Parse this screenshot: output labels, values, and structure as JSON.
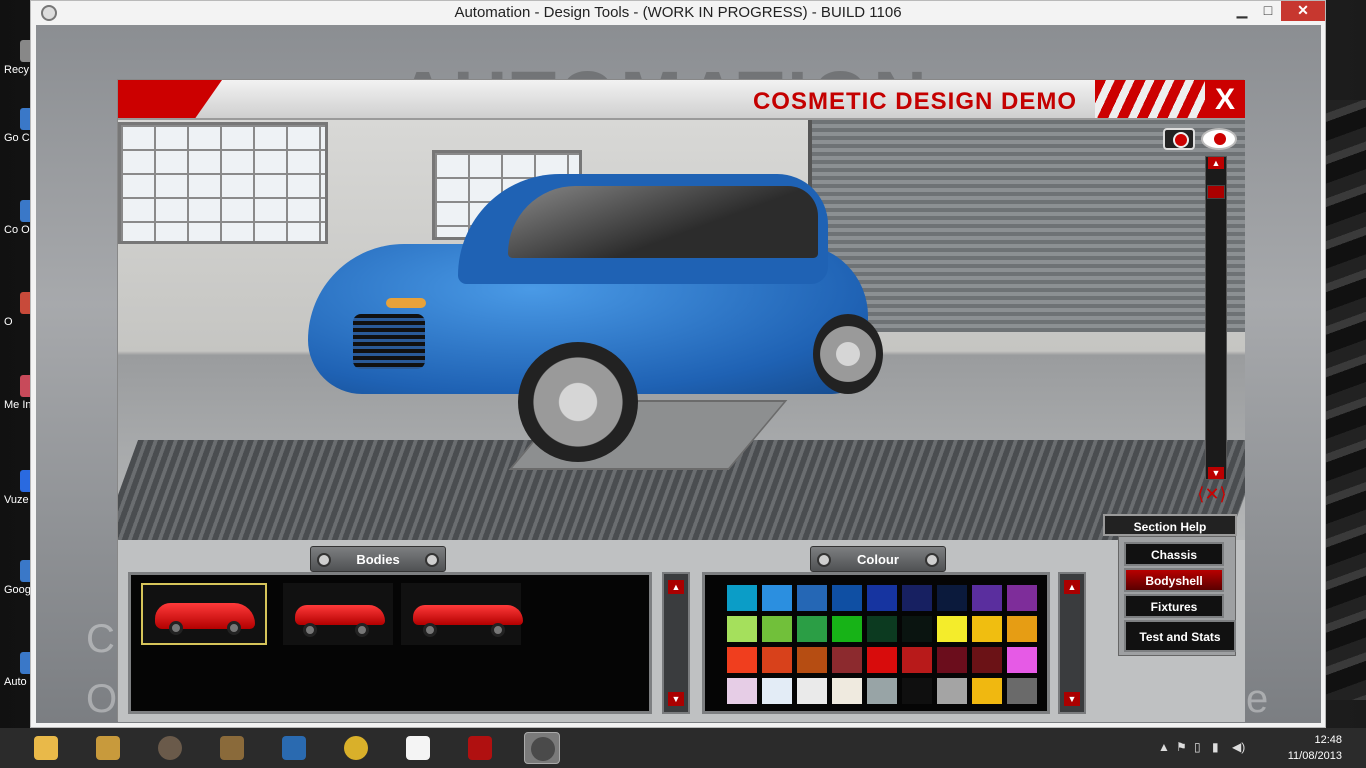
{
  "window": {
    "title": "Automation - Design Tools - (WORK IN PROGRESS) - BUILD 1106",
    "min_symbol": "▁",
    "max_symbol": "□",
    "close_symbol": "✕"
  },
  "desktop": {
    "icons": [
      "Recy",
      "Go Ch",
      "Co O",
      "O",
      "Me Intern",
      "Vuze",
      "Goog",
      "Auto"
    ]
  },
  "background_text": {
    "logo": "AUTOMATION",
    "left_c": "C",
    "left_o": "O",
    "right_e": "e"
  },
  "panel": {
    "title": "COSMETIC DESIGN DEMO",
    "close_label": "X"
  },
  "viewport": {
    "zoom_level": 0.05,
    "rotate_symbol": "⟨✕⟩"
  },
  "bodies": {
    "tab_label": "Bodies",
    "selected_index": 0,
    "items": [
      "hatchback",
      "sedan",
      "coupe"
    ]
  },
  "colour": {
    "tab_label": "Colour",
    "swatches": [
      "#0b9dc7",
      "#2b8fe0",
      "#2567b5",
      "#0f4fa3",
      "#1634a0",
      "#172061",
      "#0b1a3c",
      "#5a2e9e",
      "#7e2d9a",
      "#a5e05c",
      "#71c03a",
      "#2b9e45",
      "#17b317",
      "#0c3a20",
      "#0a1410",
      "#f4ec2b",
      "#f0be10",
      "#e69d14",
      "#f03e1e",
      "#d8411b",
      "#b64d12",
      "#8c2a2e",
      "#d80c0c",
      "#b81a1a",
      "#6b0d1c",
      "#6b1216",
      "#e65ae6",
      "#e6cde6",
      "#e3ecf6",
      "#eaeaea",
      "#efeadf",
      "#98a4a6",
      "#0f0f0f",
      "#a4a4a4",
      "#f0b810",
      "#6a6a6a"
    ]
  },
  "side_menu": {
    "section_help": "Section Help",
    "chassis": "Chassis",
    "bodyshell": "Bodyshell",
    "fixtures": "Fixtures",
    "test_and_stats": "Test and Stats",
    "active": "bodyshell"
  },
  "scroll": {
    "up": "▲",
    "down": "▼"
  },
  "taskbar": {
    "apps": [
      {
        "name": "file-explorer",
        "color": "#e9b949"
      },
      {
        "name": "utility",
        "color": "#c89a3c"
      },
      {
        "name": "speaker",
        "color": "#6a5a4a"
      },
      {
        "name": "doc-app",
        "color": "#8a6a3a"
      },
      {
        "name": "settings-app",
        "color": "#2a6ab0"
      },
      {
        "name": "chrome",
        "color": "#d9b02a"
      },
      {
        "name": "blank-file",
        "color": "#f4f4f4"
      },
      {
        "name": "power-app",
        "color": "#b01010"
      },
      {
        "name": "automation-game",
        "color": "#4a4a4a"
      }
    ],
    "tray_symbols": [
      "▲",
      "⚑",
      "▯",
      "▮",
      "◀)"
    ],
    "time": "12:48",
    "date": "11/08/2013"
  }
}
